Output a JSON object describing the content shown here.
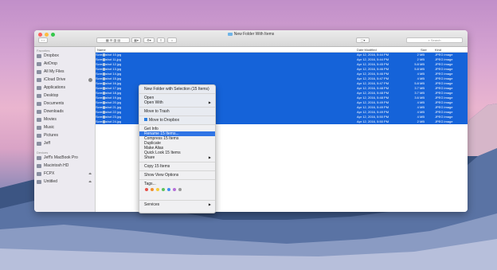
{
  "window": {
    "title": "New Folder With Items"
  },
  "toolbar": {
    "search_placeholder": "Search"
  },
  "sidebar": {
    "favorites_header": "Favorites",
    "favorites": [
      {
        "label": "Dropbox",
        "icon": "dropbox-icon"
      },
      {
        "label": "AirDrop",
        "icon": "airdrop-icon"
      },
      {
        "label": "All My Files",
        "icon": "all-files-icon"
      },
      {
        "label": "iCloud Drive",
        "icon": "cloud-icon"
      },
      {
        "label": "Applications",
        "icon": "applications-icon"
      },
      {
        "label": "Desktop",
        "icon": "desktop-icon"
      },
      {
        "label": "Documents",
        "icon": "documents-icon"
      },
      {
        "label": "Downloads",
        "icon": "downloads-icon"
      },
      {
        "label": "Movies",
        "icon": "movies-icon"
      },
      {
        "label": "Music",
        "icon": "music-icon"
      },
      {
        "label": "Pictures",
        "icon": "pictures-icon"
      },
      {
        "label": "Jeff",
        "icon": "home-icon"
      }
    ],
    "devices_header": "Devices",
    "devices": [
      {
        "label": "Jeff's MacBook Pro",
        "icon": "laptop-icon"
      },
      {
        "label": "Macintosh HD",
        "icon": "disk-icon"
      },
      {
        "label": "FCPX",
        "icon": "disk-icon"
      },
      {
        "label": "Untitled",
        "icon": "disk-icon"
      }
    ]
  },
  "columns": {
    "name": "Name",
    "date": "Date Modified",
    "size": "Size",
    "kind": "Kind"
  },
  "files": [
    {
      "name": "Screenshot 10.jpg",
      "date": "Apr 12, 2016, 5:44 PM",
      "size": "2 MB",
      "kind": "JPEG image"
    },
    {
      "name": "Screenshot 11.jpg",
      "date": "Apr 12, 2016, 5:44 PM",
      "size": "2 MB",
      "kind": "JPEG image"
    },
    {
      "name": "Screenshot 12.jpg",
      "date": "Apr 12, 2016, 5:45 PM",
      "size": "5.8 MB",
      "kind": "JPEG image"
    },
    {
      "name": "Screenshot 13.jpg",
      "date": "Apr 12, 2016, 5:46 PM",
      "size": "5.8 MB",
      "kind": "JPEG image"
    },
    {
      "name": "Screenshot 14.jpg",
      "date": "Apr 12, 2016, 5:46 PM",
      "size": "4 MB",
      "kind": "JPEG image"
    },
    {
      "name": "Screenshot 15.jpg",
      "date": "Apr 12, 2016, 5:47 PM",
      "size": "4 MB",
      "kind": "JPEG image"
    },
    {
      "name": "Screenshot 16.jpg",
      "date": "Apr 12, 2016, 5:47 PM",
      "size": "5.8 MB",
      "kind": "JPEG image"
    },
    {
      "name": "Screenshot 17.jpg",
      "date": "Apr 12, 2016, 5:48 PM",
      "size": "3.7 MB",
      "kind": "JPEG image"
    },
    {
      "name": "Screenshot 18.jpg",
      "date": "Apr 12, 2016, 5:48 PM",
      "size": "3.7 MB",
      "kind": "JPEG image"
    },
    {
      "name": "Screenshot 19.jpg",
      "date": "Apr 12, 2016, 5:48 PM",
      "size": "3.6 MB",
      "kind": "JPEG image"
    },
    {
      "name": "Screenshot 20.jpg",
      "date": "Apr 12, 2016, 5:49 PM",
      "size": "4 MB",
      "kind": "JPEG image"
    },
    {
      "name": "Screenshot 21.jpg",
      "date": "Apr 12, 2016, 5:49 PM",
      "size": "4 MB",
      "kind": "JPEG image"
    },
    {
      "name": "Screenshot 22.jpg",
      "date": "Apr 12, 2016, 5:49 PM",
      "size": "4 MB",
      "kind": "JPEG image"
    },
    {
      "name": "Screenshot 23.jpg",
      "date": "Apr 12, 2016, 5:50 PM",
      "size": "4 MB",
      "kind": "JPEG image"
    },
    {
      "name": "Screenshot 24.jpg",
      "date": "Apr 12, 2016, 5:50 PM",
      "size": "2 MB",
      "kind": "JPEG image"
    }
  ],
  "context_menu": {
    "new_folder": "New Folder with Selection (15 Items)",
    "open": "Open",
    "open_with": "Open With",
    "move_to_trash": "Move to Trash",
    "move_to_dropbox": "Move to Dropbox",
    "get_info": "Get Info",
    "rename": "Rename 15 Items...",
    "compress": "Compress 15 Items",
    "duplicate": "Duplicate",
    "make_alias": "Make Alias",
    "quick_look": "Quick Look 15 Items",
    "share": "Share",
    "copy": "Copy 15 Items",
    "show_view_options": "Show View Options",
    "tags": "Tags...",
    "tag_colors": [
      "#e5534b",
      "#f0902f",
      "#f5cc3a",
      "#5bc25b",
      "#3f8ef0",
      "#b66fd8",
      "#9a9a9a"
    ],
    "services": "Services"
  },
  "colors": {
    "selection": "#1563d9",
    "menu_highlight": "#2f74e5"
  }
}
